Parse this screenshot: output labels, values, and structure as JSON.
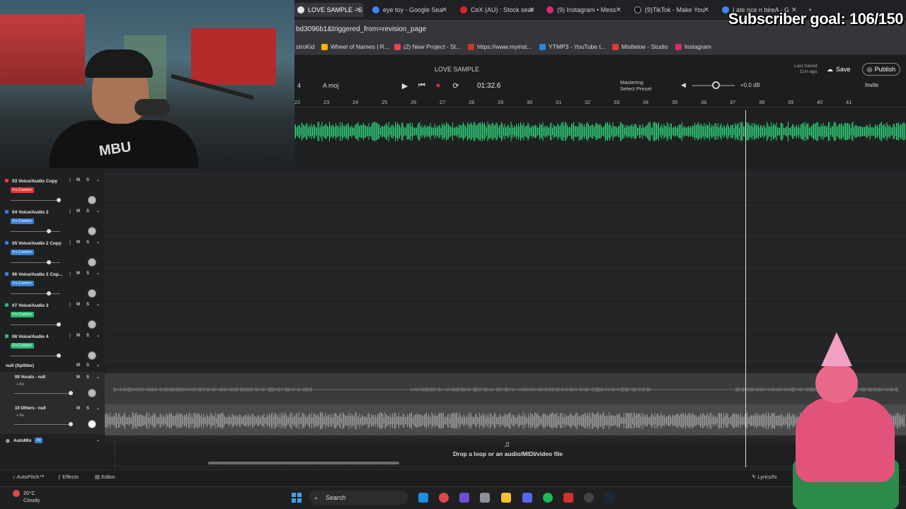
{
  "browser": {
    "tabs": [
      {
        "label": "LOVE SAMPLE - S",
        "active": true,
        "color": "#e8e8e8"
      },
      {
        "label": "eye toy - Google Sea",
        "color": "#4285f4"
      },
      {
        "label": "CeX (AU) : Stock sear",
        "color": "#e0222b"
      },
      {
        "label": "(9) Instagram • Mess",
        "color": "#d62976"
      },
      {
        "label": "(9)TikTok - Make You",
        "color": "#111111"
      },
      {
        "label": "I ate rice n bireA - G",
        "color": "#4285f4"
      }
    ],
    "url": "bd3096b1&triggered_from=revision_page",
    "bookmarks": [
      {
        "label": "stroKid",
        "color": "#888"
      },
      {
        "label": "Wheel of Names | R...",
        "color": "#f4b400"
      },
      {
        "label": "(2) New Project - St...",
        "color": "#e04848"
      },
      {
        "label": "https://www.myinst...",
        "color": "#c0392b"
      },
      {
        "label": "YTMP3 - YouTube t...",
        "color": "#1e88e5"
      },
      {
        "label": "Mistletoe - Studio",
        "color": "#e53935"
      },
      {
        "label": "Instagram",
        "color": "#d62976"
      }
    ]
  },
  "overlay": {
    "subscriber_goal": "Subscriber goal: 106/150",
    "shirt_text": "MBU"
  },
  "daw": {
    "project_title": "LOVE SAMPLE",
    "bar_number": "4",
    "tool_label": "moj",
    "time": "01:32.6",
    "mastering_label": "Mastering",
    "mastering_sub": "Select Preset",
    "db_value": "+0.0 dB",
    "last_saved": "Last Saved",
    "last_saved_time": "11m ago",
    "save_label": "Save",
    "publish_label": "Publish",
    "invite_label": "Invite",
    "ruler": [
      "22",
      "23",
      "24",
      "25",
      "26",
      "27",
      "28",
      "29",
      "30",
      "31",
      "32",
      "33",
      "34",
      "35",
      "36",
      "37",
      "38",
      "39",
      "40",
      "41"
    ],
    "tracks": [
      {
        "name": "03 Voice/Audio Copy",
        "fx": "Fx Custom",
        "fx_color": "#e03a3a",
        "color": "#e03a3a",
        "vol": 0.97
      },
      {
        "name": "04 Voice/Audio 2",
        "fx": "Fx Custom",
        "fx_color": "#3b7fd4",
        "color": "#3b7fd4",
        "vol": 0.77
      },
      {
        "name": "05 Voice/Audio 2 Copy",
        "fx": "Fx Custom",
        "fx_color": "#3b7fd4",
        "color": "#3b7fd4",
        "vol": 0.77
      },
      {
        "name": "06 Voice/Audio 2 Cop...",
        "fx": "Fx Custom",
        "fx_color": "#3b7fd4",
        "color": "#3b7fd4",
        "vol": 0.77
      },
      {
        "name": "07 Voice/Audio 3",
        "fx": "Fx Custom",
        "fx_color": "#2eb872",
        "color": "#2eb872",
        "vol": 0.97
      },
      {
        "name": "08 Voice/Audio 4",
        "fx": "Fx Custom",
        "fx_color": "#2eb872",
        "color": "#2eb872",
        "vol": 0.97
      }
    ],
    "splitter_label": "null (Splitter)",
    "split_tracks": [
      {
        "name": "09 Vocals - null",
        "fx": "+ Fx"
      },
      {
        "name": "10 Others - null",
        "fx": "+ Fx"
      }
    ],
    "automix_label": "AutoMix",
    "automix_badge": "AI",
    "mute_label": "M",
    "solo_label": "S",
    "drop_text": "Drop a loop or an audio/MIDI/video file",
    "bottom_tools": [
      "AutoPitch™",
      "Effects",
      "Editor"
    ],
    "lyrics_label": "Lyrics/N"
  },
  "taskbar": {
    "temperature": "20°C",
    "condition": "Cloudy",
    "search_label": "Search",
    "icons": [
      {
        "name": "edge-icon",
        "color": "#1b8fe0"
      },
      {
        "name": "chrome-icon",
        "color": "#e04848"
      },
      {
        "name": "copilot-icon",
        "color": "#6f4fd8"
      },
      {
        "name": "settings-icon",
        "color": "#8a8f98"
      },
      {
        "name": "explorer-icon",
        "color": "#f4c030"
      },
      {
        "name": "discord-icon",
        "color": "#5865f2"
      },
      {
        "name": "spotify-icon",
        "color": "#1db954"
      },
      {
        "name": "app-red-icon",
        "color": "#d32f2f"
      },
      {
        "name": "obs-icon",
        "color": "#444"
      },
      {
        "name": "steam-icon",
        "color": "#1b2838"
      }
    ]
  }
}
